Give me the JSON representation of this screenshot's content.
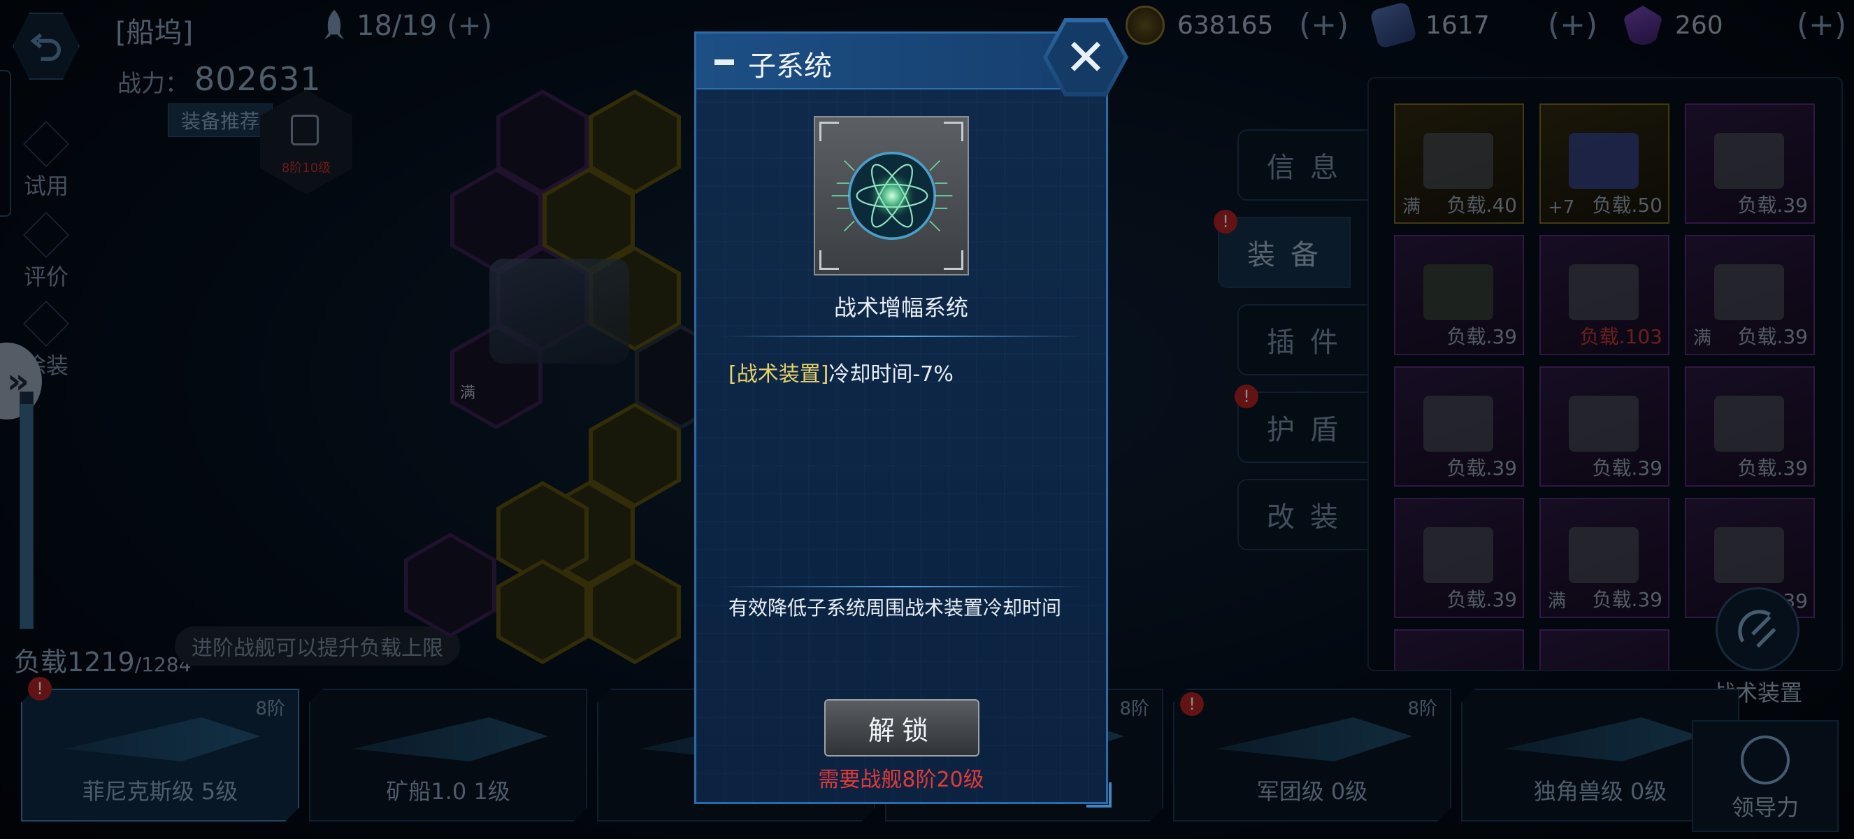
{
  "topbar": {
    "dock_title": "[船坞]",
    "slots": "18/19",
    "plus_bracket": "(+)",
    "currency1": "638165",
    "currency2": "1617",
    "currency3": "260"
  },
  "left": {
    "power_label": "战力：",
    "power_value": "802631",
    "recommend_btn": "装备推荐",
    "menu_trial": "试用",
    "menu_review": "评价",
    "menu_paint": "涂装",
    "load_label": "负载",
    "load_current": "1219",
    "load_max": "/1284",
    "load_fraction": 0.949,
    "hint": "进阶战舰可以提升负载上限",
    "lock_text": "8阶10级",
    "full_text": "满"
  },
  "tabs": {
    "info": "信息",
    "equip": "装备",
    "plugin": "插件",
    "shield": "护盾",
    "modify": "改装"
  },
  "inventory": [
    {
      "tag": "满",
      "label": "负载.40"
    },
    {
      "tag": "+7",
      "label": "负载.50"
    },
    {
      "tag": "",
      "label": "负载.39"
    },
    {
      "tag": "",
      "label": "负载.39"
    },
    {
      "tag": "",
      "label": "负载.103"
    },
    {
      "tag": "满",
      "label": "负载.39"
    },
    {
      "tag": "",
      "label": "负载.39"
    },
    {
      "tag": "",
      "label": "负载.39"
    },
    {
      "tag": "",
      "label": "负载.39"
    },
    {
      "tag": "",
      "label": "负载.39"
    },
    {
      "tag": "满",
      "label": "负载.39"
    },
    {
      "tag": "",
      "label": "39"
    }
  ],
  "tactical_label": "战术装置",
  "ships": [
    {
      "rank": "8阶",
      "name": "菲尼克斯级 5级"
    },
    {
      "rank": "",
      "name": "矿船1.0 1级"
    },
    {
      "rank": "",
      "name": ""
    },
    {
      "rank": "8阶",
      "name": ""
    },
    {
      "rank": "8阶",
      "name": "军团级 0级"
    },
    {
      "rank": "",
      "name": "独角兽级 0级"
    }
  ],
  "leadership_label": "领导力",
  "modal": {
    "title": "子系统",
    "item_name": "战术增幅系统",
    "effect_tag": "[战术装置]",
    "effect_text": "冷却时间-7%",
    "description": "有效降低子系统周围战术装置冷却时间",
    "unlock_btn": "解锁",
    "requirement": "需要战舰8阶20级"
  },
  "colors": {
    "accent": "#2c6aa8",
    "highlight": "#e6d16a",
    "warning": "#e23a3a"
  }
}
